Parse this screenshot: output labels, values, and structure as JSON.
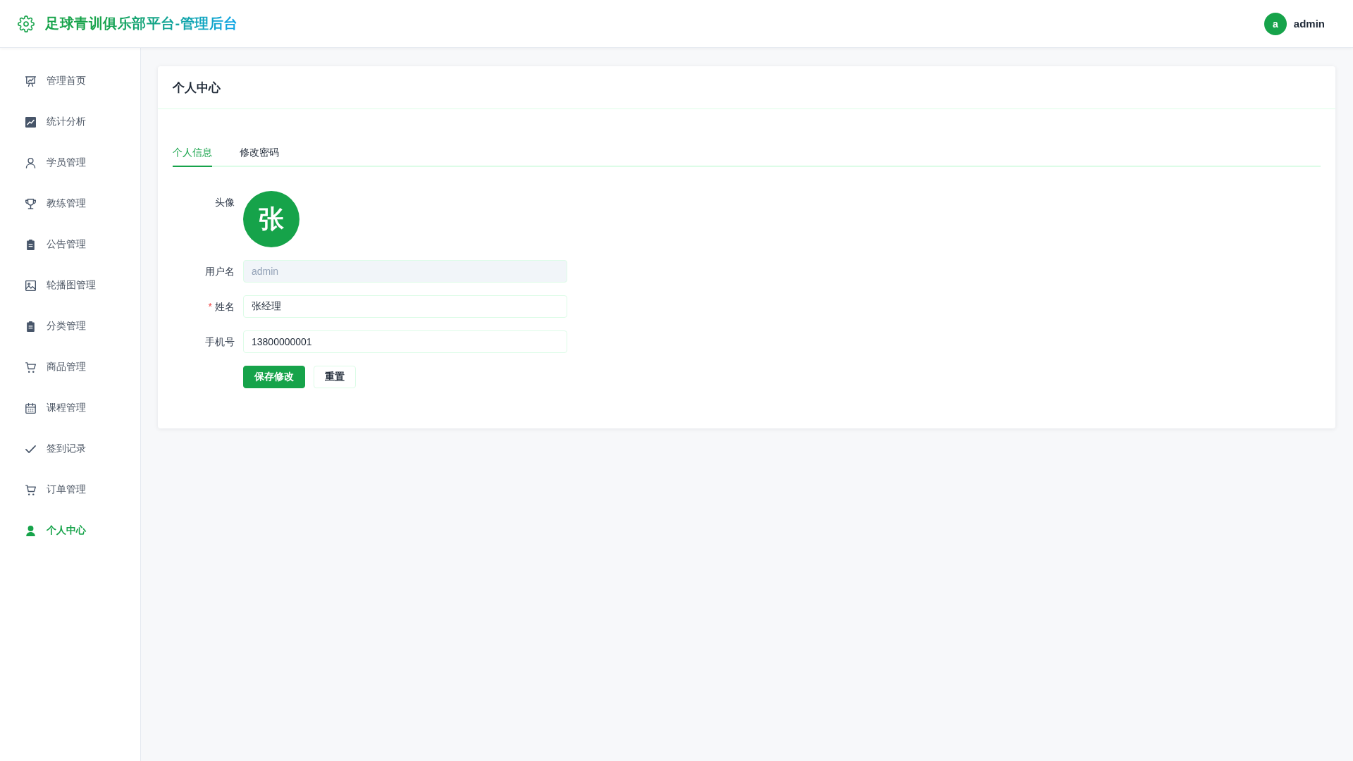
{
  "header": {
    "title": "足球青训俱乐部平台-管理后台",
    "user": {
      "initial": "a",
      "name": "admin"
    }
  },
  "sidebar": {
    "items": [
      {
        "label": "管理首页",
        "selected": false
      },
      {
        "label": "统计分析",
        "selected": false
      },
      {
        "label": "学员管理",
        "selected": false
      },
      {
        "label": "教练管理",
        "selected": false
      },
      {
        "label": "公告管理",
        "selected": false
      },
      {
        "label": "轮播图管理",
        "selected": false
      },
      {
        "label": "分类管理",
        "selected": false
      },
      {
        "label": "商品管理",
        "selected": false
      },
      {
        "label": "课程管理",
        "selected": false
      },
      {
        "label": "签到记录",
        "selected": false
      },
      {
        "label": "订单管理",
        "selected": false
      },
      {
        "label": "个人中心",
        "selected": true
      }
    ]
  },
  "page": {
    "title": "个人中心",
    "tabs": [
      {
        "label": "个人信息",
        "selected": true
      },
      {
        "label": "修改密码",
        "selected": false
      }
    ],
    "form": {
      "required_mark": "*",
      "avatar": {
        "label": "头像",
        "initial": "张"
      },
      "fields": [
        {
          "label": "用户名",
          "value": "admin",
          "disabled": true,
          "required": false
        },
        {
          "label": "姓名",
          "value": "张经理",
          "disabled": false,
          "required": true
        },
        {
          "label": "手机号",
          "value": "13800000001",
          "disabled": false,
          "required": false
        }
      ],
      "buttons": [
        {
          "label": "保存修改",
          "kind": "primary"
        },
        {
          "label": "重置",
          "kind": "default"
        }
      ]
    }
  }
}
